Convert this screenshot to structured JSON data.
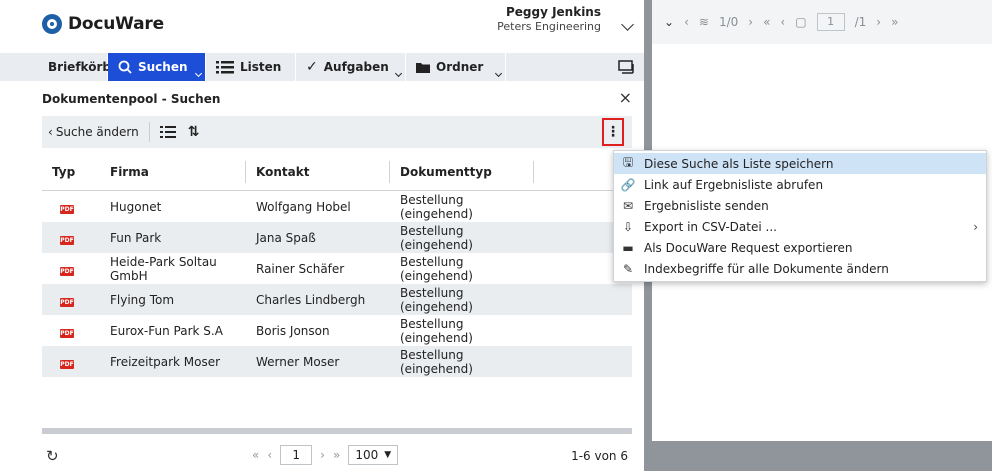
{
  "brand": {
    "name": "DocuWare",
    "color": "#1f5fa8"
  },
  "user": {
    "name": "Peggy Jenkins",
    "company": "Peters Engineering"
  },
  "nav": {
    "items": [
      {
        "label": "Briefkörbe",
        "icon": "inbox-icon"
      },
      {
        "label": "Suchen",
        "icon": "search-icon",
        "active": true
      },
      {
        "label": "Listen",
        "icon": "list-icon"
      },
      {
        "label": "Aufgaben",
        "icon": "check-icon"
      },
      {
        "label": "Ordner",
        "icon": "folder-icon"
      }
    ],
    "accent": "#1d4ed8"
  },
  "pane": {
    "title": "Dokumentenpool - Suchen"
  },
  "toolbar": {
    "back_label": "Suche ändern"
  },
  "table": {
    "headers": [
      "Typ",
      "Firma",
      "Kontakt",
      "Dokumenttyp"
    ],
    "rows": [
      {
        "firma": "Hugonet",
        "kontakt": "Wolfgang Hobel",
        "doktyp": "Bestellung (eingehend)"
      },
      {
        "firma": "Fun Park",
        "kontakt": "Jana Spaß",
        "doktyp": "Bestellung (eingehend)"
      },
      {
        "firma": "Heide-Park Soltau GmbH",
        "kontakt": "Rainer Schäfer",
        "doktyp": "Bestellung (eingehend)"
      },
      {
        "firma": "Flying Tom",
        "kontakt": "Charles Lindbergh",
        "doktyp": "Bestellung (eingehend)"
      },
      {
        "firma": "Eurox-Fun Park S.A",
        "kontakt": "Boris Jonson",
        "doktyp": "Bestellung (eingehend)"
      },
      {
        "firma": "Freizeitpark Moser",
        "kontakt": "Werner Moser",
        "doktyp": "Bestellung (eingehend)"
      }
    ],
    "type_badge": "PDF"
  },
  "footer": {
    "page": "1",
    "page_size": "100",
    "count": "1-6 von 6"
  },
  "viewer": {
    "page_counter": "1/0",
    "page_input": "1",
    "page_total": "/1"
  },
  "menu": {
    "items": [
      {
        "label": "Diese Suche als Liste speichern",
        "icon": "save-icon",
        "glyph": "🖫",
        "highlight": true
      },
      {
        "label": "Link auf Ergebnisliste abrufen",
        "icon": "link-icon",
        "glyph": "🔗"
      },
      {
        "label": "Ergebnisliste senden",
        "icon": "mail-icon",
        "glyph": "✉"
      },
      {
        "label": "Export in CSV-Datei ...",
        "icon": "export-icon",
        "glyph": "⇩",
        "submenu": true
      },
      {
        "label": "Als DocuWare Request exportieren",
        "icon": "request-icon",
        "glyph": "▬"
      },
      {
        "label": "Indexbegriffe für alle Dokumente ändern",
        "icon": "edit-index-icon",
        "glyph": "✎"
      }
    ]
  }
}
